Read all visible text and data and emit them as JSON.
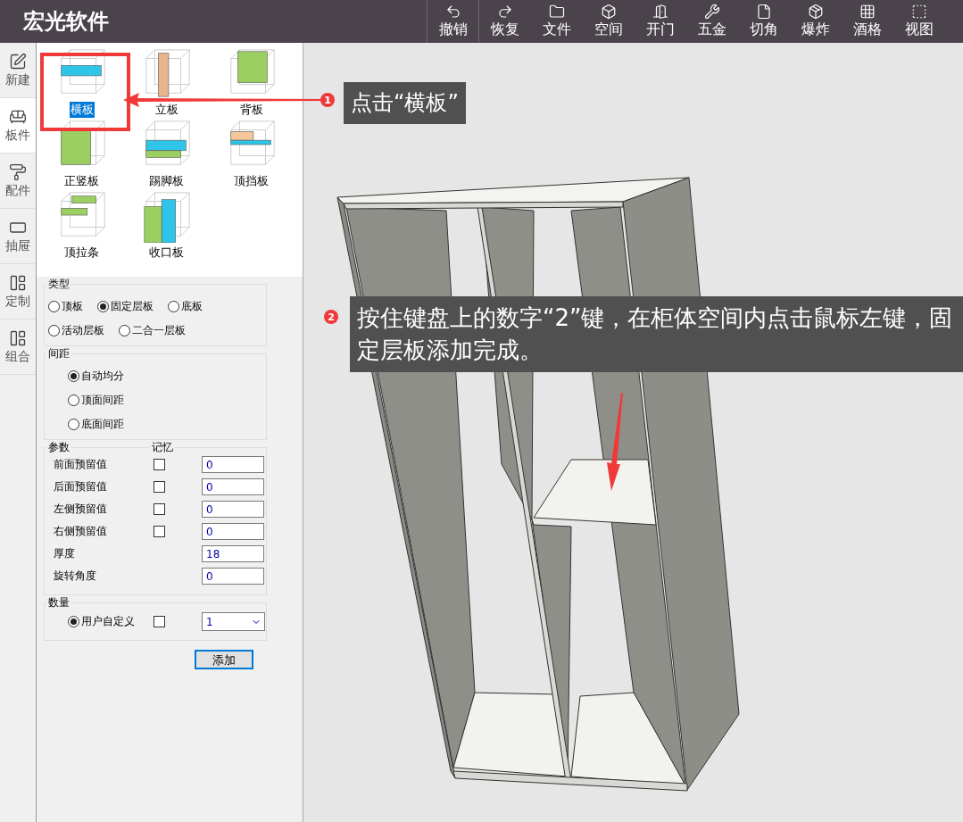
{
  "app": {
    "title": "宏光软件"
  },
  "toolbar": [
    {
      "label": "撤销"
    },
    {
      "label": "恢复"
    },
    {
      "label": "文件"
    },
    {
      "label": "空间"
    },
    {
      "label": "开门"
    },
    {
      "label": "五金"
    },
    {
      "label": "切角"
    },
    {
      "label": "爆炸"
    },
    {
      "label": "酒格"
    },
    {
      "label": "视图"
    }
  ],
  "sidebar": [
    {
      "label": "新建",
      "selected": false
    },
    {
      "label": "板件",
      "selected": true
    },
    {
      "label": "配件",
      "selected": false
    },
    {
      "label": "抽屉",
      "selected": false
    },
    {
      "label": "定制",
      "selected": false
    },
    {
      "label": "组合",
      "selected": false
    }
  ],
  "components": [
    {
      "label": "横板",
      "selected": true
    },
    {
      "label": "立板",
      "selected": false
    },
    {
      "label": "背板",
      "selected": false
    },
    {
      "label": "正竖板",
      "selected": false
    },
    {
      "label": "踢脚板",
      "selected": false
    },
    {
      "label": "顶挡板",
      "selected": false
    },
    {
      "label": "顶拉条",
      "selected": false
    },
    {
      "label": "收口板",
      "selected": false
    }
  ],
  "type_group": {
    "title": "类型",
    "options": [
      {
        "label": "顶板",
        "selected": false
      },
      {
        "label": "固定层板",
        "selected": true
      },
      {
        "label": "底板",
        "selected": false
      },
      {
        "label": "活动层板",
        "selected": false
      },
      {
        "label": "二合一层板",
        "selected": false
      }
    ]
  },
  "spacing_group": {
    "title": "间距",
    "options": [
      {
        "label": "自动均分",
        "selected": true
      },
      {
        "label": "顶面间距",
        "selected": false
      },
      {
        "label": "底面间距",
        "selected": false
      }
    ]
  },
  "params_group": {
    "title": "参数",
    "memory_label": "记忆",
    "rows": [
      {
        "kind": "memory",
        "label": "前面预留值",
        "checked": false,
        "value": "0"
      },
      {
        "kind": "memory",
        "label": "后面预留值",
        "checked": false,
        "value": "0"
      },
      {
        "kind": "memory",
        "label": "左侧预留值",
        "checked": false,
        "value": "0"
      },
      {
        "kind": "memory",
        "label": "右侧预留值",
        "checked": false,
        "value": "0"
      },
      {
        "kind": "plain",
        "label": "厚度",
        "value": "18"
      },
      {
        "kind": "plain",
        "label": "旋转角度",
        "value": "0"
      }
    ]
  },
  "quantity_group": {
    "title": "数量",
    "option": {
      "label": "用户自定义",
      "selected": true
    },
    "checked": false,
    "value": "1"
  },
  "add_button": "添加",
  "callouts": [
    {
      "number": "1",
      "text": "点击“横板”"
    },
    {
      "number": "2",
      "text": "按住键盘上的数字“2”键，在柜体空间内点击鼠标左键，固定层板添加完成。"
    }
  ]
}
